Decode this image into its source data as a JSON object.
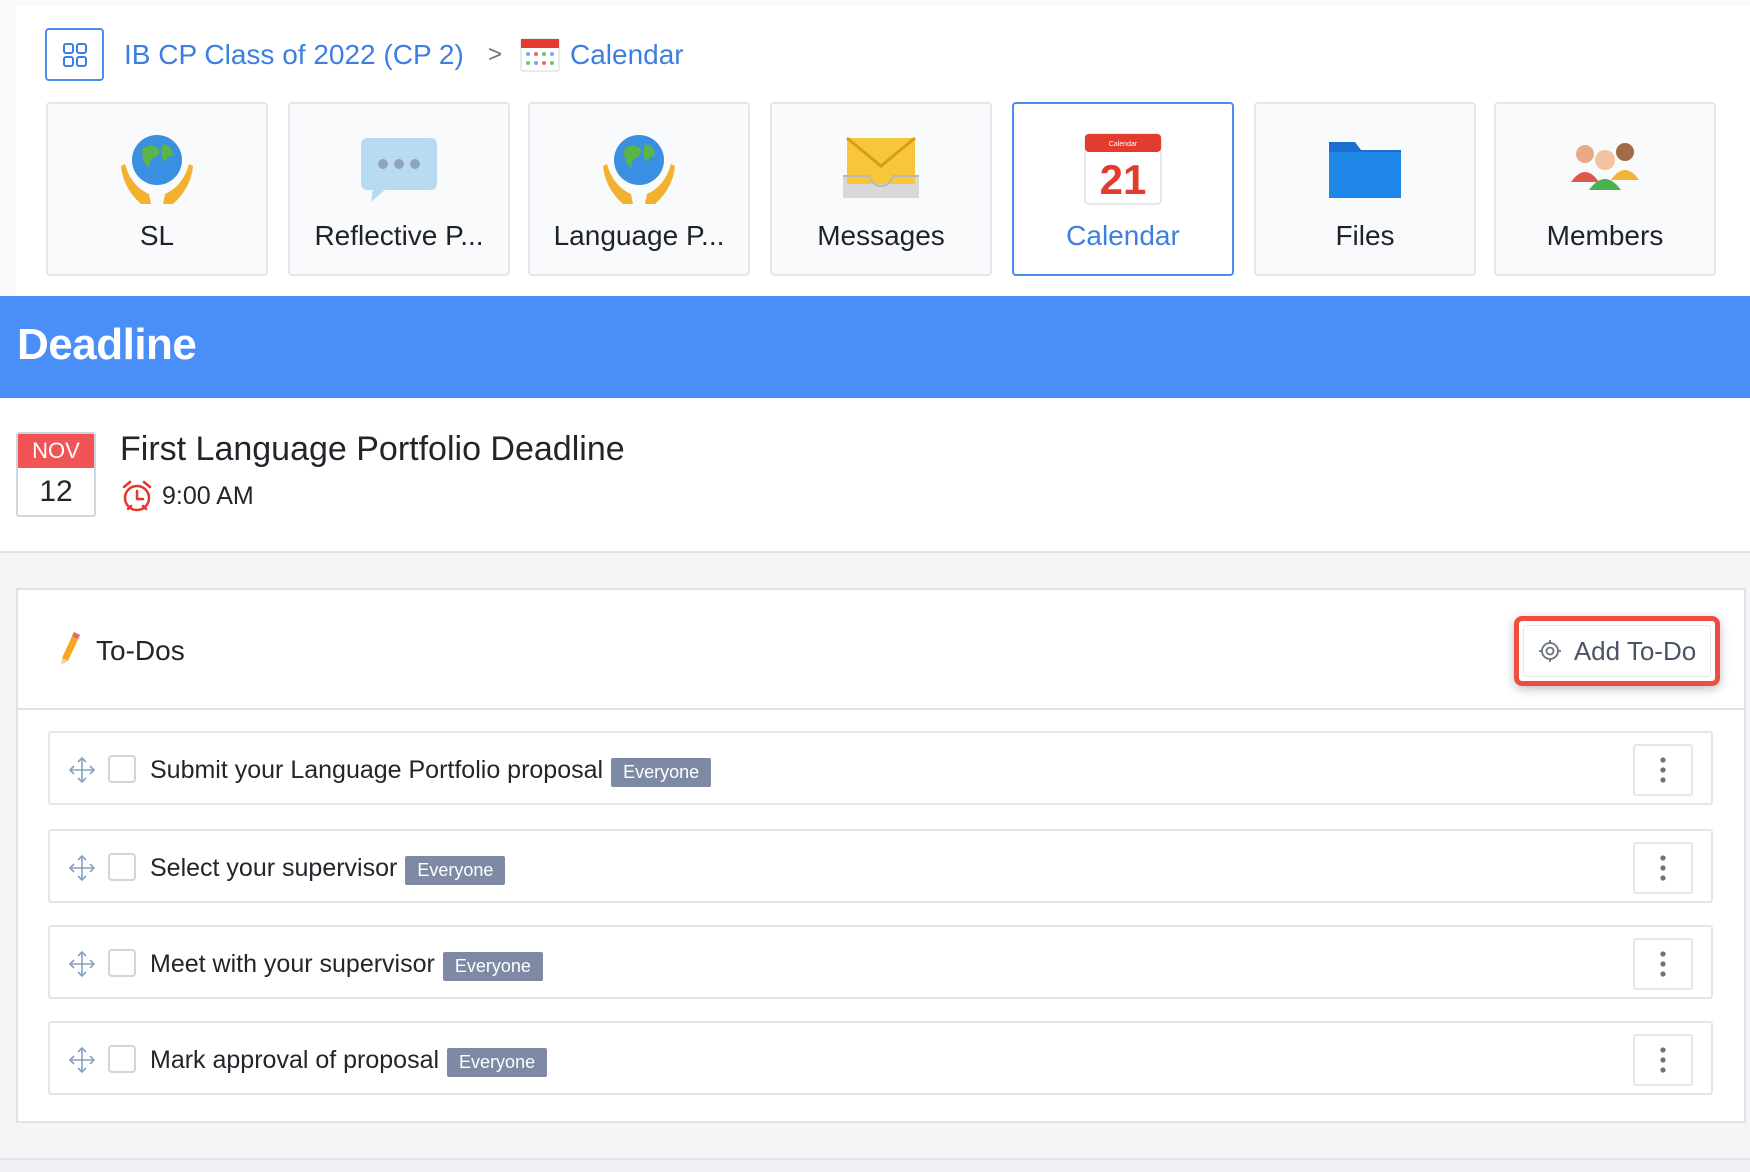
{
  "breadcrumb": {
    "course": "IB CP Class of 2022 (CP 2)",
    "separator": ">",
    "current": "Calendar"
  },
  "tiles": [
    {
      "label": "SL",
      "icon": "globe-hands-icon"
    },
    {
      "label": "Reflective P...",
      "icon": "speech-bubble-icon"
    },
    {
      "label": "Language P...",
      "icon": "globe-hands-icon"
    },
    {
      "label": "Messages",
      "icon": "envelope-icon"
    },
    {
      "label": "Calendar",
      "icon": "calendar-21-icon",
      "active": true
    },
    {
      "label": "Files",
      "icon": "folder-icon"
    },
    {
      "label": "Members",
      "icon": "members-icon"
    }
  ],
  "calendar_icon_text": {
    "header": "Calendar",
    "day": "21"
  },
  "section_title": "Deadline",
  "event": {
    "month": "NOV",
    "day": "12",
    "title": "First Language Portfolio Deadline",
    "time": "9:00 AM"
  },
  "todos": {
    "title": "To-Dos",
    "add_label": "Add To-Do",
    "items": [
      {
        "label": "Submit your Language Portfolio proposal",
        "badge": "Everyone"
      },
      {
        "label": "Select your supervisor",
        "badge": "Everyone"
      },
      {
        "label": "Meet with your supervisor",
        "badge": "Everyone"
      },
      {
        "label": "Mark approval of proposal",
        "badge": "Everyone"
      }
    ]
  },
  "colors": {
    "accent": "#4a8ff7",
    "link": "#3d7fe0",
    "date_red": "#f05454",
    "highlight": "#ee4e42",
    "badge": "#7e8aa3"
  }
}
